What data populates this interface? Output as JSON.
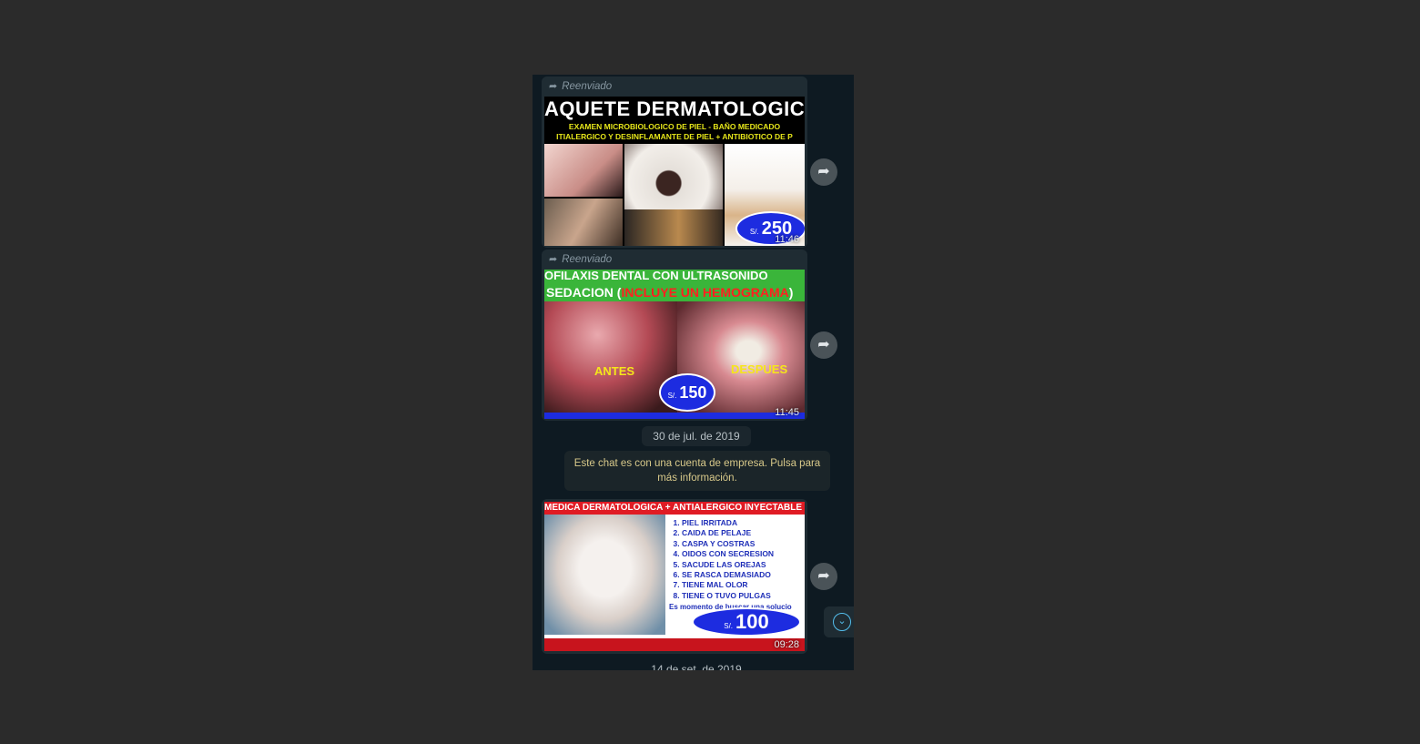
{
  "colors": {
    "page_bg": "#2b2b2b",
    "chat_bg": "#0e1a22",
    "bubble_bg": "#1f2c33",
    "accent": "#53bdeb",
    "price_blue": "#1d2ce0"
  },
  "messages": [
    {
      "forward_label": "Reenviado",
      "time": "11:46",
      "poster": {
        "title": "AQUETE DERMATOLOGIC",
        "subtitle_line1": "EXAMEN MICROBIOLOGICO DE PIEL - BAÑO MEDICADO",
        "subtitle_line2": "ITIALERGICO Y DESINFLAMANTE DE PIEL + ANTIBIOTICO DE P",
        "currency": "S/.",
        "price": "250"
      },
      "share_icon": "forward-arrow-icon"
    },
    {
      "forward_label": "Reenviado",
      "time": "11:45",
      "poster": {
        "title_line1": "OFILAXIS DENTAL CON ULTRASONIDO",
        "title_line2_prefix": "SEDACION (",
        "title_line2_highlight": "INCLUYE UN HEMOGRAMA",
        "title_line2_suffix": ")",
        "before_label": "ANTES",
        "after_label": "DESPUES",
        "currency": "S/.",
        "price": "150"
      },
      "share_icon": "forward-arrow-icon"
    }
  ],
  "date_separator_1": "30 de jul. de 2019",
  "business_notice": "Este chat es con una cuenta de empresa. Pulsa para más información.",
  "third_message": {
    "time": "09:28",
    "poster": {
      "banner": "MEDICA DERMATOLOGICA + ANTIALERGICO INYECTABLE",
      "items": [
        "PIEL IRRITADA",
        "CAIDA DE PELAJE",
        "CASPA Y COSTRAS",
        "OIDOS CON SECRESION",
        "SACUDE LAS OREJAS",
        "SE RASCA DEMASIADO",
        "TIENE MAL OLOR",
        "TIENE O TUVO PULGAS"
      ],
      "extra": "Es momento de buscar una solucio",
      "currency": "S/.",
      "price": "100"
    }
  },
  "date_separator_2": "14 de set. de 2019",
  "scroll_icon": "chevron-down-icon"
}
